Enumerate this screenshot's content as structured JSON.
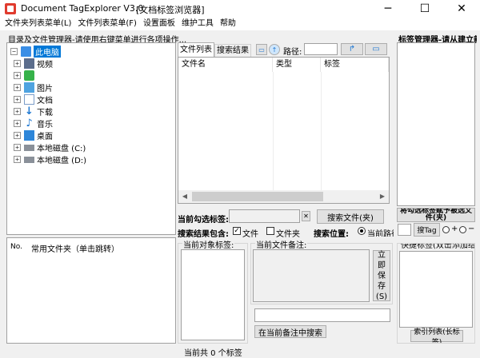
{
  "window": {
    "title": "Document TagExplorer  V3.0",
    "subtitle": "[文档标签浏览器]",
    "minimize_glyph": "─",
    "maximize_glyph": "☐",
    "close_glyph": "✕"
  },
  "menu": [
    "文件夹列表菜单(L)",
    "文件列表菜单(F)",
    "设置面板",
    "维护工具",
    "帮助"
  ],
  "left_panel": {
    "caption": "目录及文件管理器-请使用右键菜单进行各项操作...",
    "tree": [
      {
        "label": "此电脑",
        "icon": "computer-icon",
        "selected": true
      },
      {
        "label": "视频",
        "icon": "video-folder-icon"
      },
      {
        "label": "",
        "icon": "green-app-icon"
      },
      {
        "label": "图片",
        "icon": "pictures-folder-icon"
      },
      {
        "label": "文档",
        "icon": "documents-folder-icon"
      },
      {
        "label": "下载",
        "icon": "download-icon"
      },
      {
        "label": "音乐",
        "icon": "music-icon"
      },
      {
        "label": "桌面",
        "icon": "desktop-icon"
      },
      {
        "label": "本地磁盘 (C:)",
        "icon": "drive-icon"
      },
      {
        "label": "本地磁盘 (D:)",
        "icon": "drive-icon"
      }
    ],
    "favorites_header": {
      "no": "No.",
      "name": "常用文件夹（单击跳转）"
    }
  },
  "middle": {
    "tabs": [
      "文件列表",
      "搜索结果"
    ],
    "path_label": "路径:",
    "path_value": "",
    "columns": [
      "文件名",
      "类型",
      "标签"
    ],
    "selected_tags_label": "当前勾选标签:",
    "clear_glyph": "✕",
    "search_files_button": "搜索文件(夹)",
    "search_includes_label": "搜索结果包含:",
    "include_file": "文件",
    "include_folder": "文件夹",
    "search_location_label": "搜索位置:",
    "location_current": "当前路径",
    "current_tags_title": "当前对象标签:",
    "current_note_title": "当前文件备注:",
    "save_button": "立即保存(S)",
    "search_in_note_button": "在当前备注中搜索"
  },
  "right_panel": {
    "caption": "标签管理器-请从建立新标签",
    "assign_button": "将勾选标签赋予被选文件(夹)",
    "search_tag_button": "搜Tag",
    "plus_label": "+",
    "minus_label": "−",
    "quick_tags_title": "快捷标签(双击添加给",
    "index_list_button": "索引列表(长标签)"
  },
  "status": {
    "text": "当前共 0 个标签"
  },
  "colors": {
    "selection": "#0078d7",
    "folder": "#f3c94a",
    "accent_blue": "#1e78d2"
  }
}
